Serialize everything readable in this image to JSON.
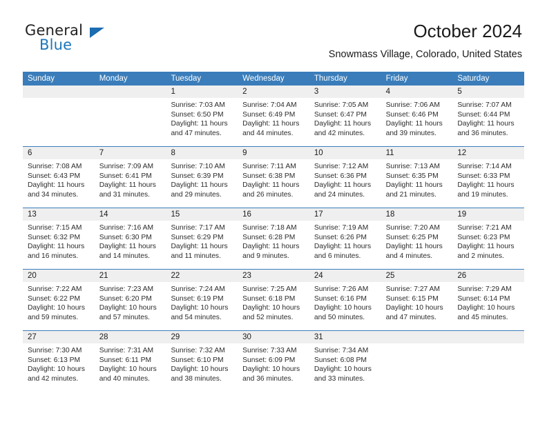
{
  "brand": {
    "word_one": "General",
    "word_two": "Blue",
    "accent_color": "#1b76bc",
    "triangle_color": "#1b6cb0"
  },
  "header": {
    "title": "October 2024",
    "subtitle": "Snowmass Village, Colorado, United States"
  },
  "calendar": {
    "header_color": "#3a7dba",
    "daynum_band_color": "#efefef",
    "day_names": [
      "Sunday",
      "Monday",
      "Tuesday",
      "Wednesday",
      "Thursday",
      "Friday",
      "Saturday"
    ],
    "weeks": [
      [
        {
          "day": "",
          "empty": true,
          "sunrise": "",
          "sunset": "",
          "daylight_line1": "",
          "daylight_line2": ""
        },
        {
          "day": "",
          "empty": true,
          "sunrise": "",
          "sunset": "",
          "daylight_line1": "",
          "daylight_line2": ""
        },
        {
          "day": "1",
          "empty": false,
          "sunrise": "Sunrise: 7:03 AM",
          "sunset": "Sunset: 6:50 PM",
          "daylight_line1": "Daylight: 11 hours",
          "daylight_line2": "and 47 minutes."
        },
        {
          "day": "2",
          "empty": false,
          "sunrise": "Sunrise: 7:04 AM",
          "sunset": "Sunset: 6:49 PM",
          "daylight_line1": "Daylight: 11 hours",
          "daylight_line2": "and 44 minutes."
        },
        {
          "day": "3",
          "empty": false,
          "sunrise": "Sunrise: 7:05 AM",
          "sunset": "Sunset: 6:47 PM",
          "daylight_line1": "Daylight: 11 hours",
          "daylight_line2": "and 42 minutes."
        },
        {
          "day": "4",
          "empty": false,
          "sunrise": "Sunrise: 7:06 AM",
          "sunset": "Sunset: 6:46 PM",
          "daylight_line1": "Daylight: 11 hours",
          "daylight_line2": "and 39 minutes."
        },
        {
          "day": "5",
          "empty": false,
          "sunrise": "Sunrise: 7:07 AM",
          "sunset": "Sunset: 6:44 PM",
          "daylight_line1": "Daylight: 11 hours",
          "daylight_line2": "and 36 minutes."
        }
      ],
      [
        {
          "day": "6",
          "empty": false,
          "sunrise": "Sunrise: 7:08 AM",
          "sunset": "Sunset: 6:43 PM",
          "daylight_line1": "Daylight: 11 hours",
          "daylight_line2": "and 34 minutes."
        },
        {
          "day": "7",
          "empty": false,
          "sunrise": "Sunrise: 7:09 AM",
          "sunset": "Sunset: 6:41 PM",
          "daylight_line1": "Daylight: 11 hours",
          "daylight_line2": "and 31 minutes."
        },
        {
          "day": "8",
          "empty": false,
          "sunrise": "Sunrise: 7:10 AM",
          "sunset": "Sunset: 6:39 PM",
          "daylight_line1": "Daylight: 11 hours",
          "daylight_line2": "and 29 minutes."
        },
        {
          "day": "9",
          "empty": false,
          "sunrise": "Sunrise: 7:11 AM",
          "sunset": "Sunset: 6:38 PM",
          "daylight_line1": "Daylight: 11 hours",
          "daylight_line2": "and 26 minutes."
        },
        {
          "day": "10",
          "empty": false,
          "sunrise": "Sunrise: 7:12 AM",
          "sunset": "Sunset: 6:36 PM",
          "daylight_line1": "Daylight: 11 hours",
          "daylight_line2": "and 24 minutes."
        },
        {
          "day": "11",
          "empty": false,
          "sunrise": "Sunrise: 7:13 AM",
          "sunset": "Sunset: 6:35 PM",
          "daylight_line1": "Daylight: 11 hours",
          "daylight_line2": "and 21 minutes."
        },
        {
          "day": "12",
          "empty": false,
          "sunrise": "Sunrise: 7:14 AM",
          "sunset": "Sunset: 6:33 PM",
          "daylight_line1": "Daylight: 11 hours",
          "daylight_line2": "and 19 minutes."
        }
      ],
      [
        {
          "day": "13",
          "empty": false,
          "sunrise": "Sunrise: 7:15 AM",
          "sunset": "Sunset: 6:32 PM",
          "daylight_line1": "Daylight: 11 hours",
          "daylight_line2": "and 16 minutes."
        },
        {
          "day": "14",
          "empty": false,
          "sunrise": "Sunrise: 7:16 AM",
          "sunset": "Sunset: 6:30 PM",
          "daylight_line1": "Daylight: 11 hours",
          "daylight_line2": "and 14 minutes."
        },
        {
          "day": "15",
          "empty": false,
          "sunrise": "Sunrise: 7:17 AM",
          "sunset": "Sunset: 6:29 PM",
          "daylight_line1": "Daylight: 11 hours",
          "daylight_line2": "and 11 minutes."
        },
        {
          "day": "16",
          "empty": false,
          "sunrise": "Sunrise: 7:18 AM",
          "sunset": "Sunset: 6:28 PM",
          "daylight_line1": "Daylight: 11 hours",
          "daylight_line2": "and 9 minutes."
        },
        {
          "day": "17",
          "empty": false,
          "sunrise": "Sunrise: 7:19 AM",
          "sunset": "Sunset: 6:26 PM",
          "daylight_line1": "Daylight: 11 hours",
          "daylight_line2": "and 6 minutes."
        },
        {
          "day": "18",
          "empty": false,
          "sunrise": "Sunrise: 7:20 AM",
          "sunset": "Sunset: 6:25 PM",
          "daylight_line1": "Daylight: 11 hours",
          "daylight_line2": "and 4 minutes."
        },
        {
          "day": "19",
          "empty": false,
          "sunrise": "Sunrise: 7:21 AM",
          "sunset": "Sunset: 6:23 PM",
          "daylight_line1": "Daylight: 11 hours",
          "daylight_line2": "and 2 minutes."
        }
      ],
      [
        {
          "day": "20",
          "empty": false,
          "sunrise": "Sunrise: 7:22 AM",
          "sunset": "Sunset: 6:22 PM",
          "daylight_line1": "Daylight: 10 hours",
          "daylight_line2": "and 59 minutes."
        },
        {
          "day": "21",
          "empty": false,
          "sunrise": "Sunrise: 7:23 AM",
          "sunset": "Sunset: 6:20 PM",
          "daylight_line1": "Daylight: 10 hours",
          "daylight_line2": "and 57 minutes."
        },
        {
          "day": "22",
          "empty": false,
          "sunrise": "Sunrise: 7:24 AM",
          "sunset": "Sunset: 6:19 PM",
          "daylight_line1": "Daylight: 10 hours",
          "daylight_line2": "and 54 minutes."
        },
        {
          "day": "23",
          "empty": false,
          "sunrise": "Sunrise: 7:25 AM",
          "sunset": "Sunset: 6:18 PM",
          "daylight_line1": "Daylight: 10 hours",
          "daylight_line2": "and 52 minutes."
        },
        {
          "day": "24",
          "empty": false,
          "sunrise": "Sunrise: 7:26 AM",
          "sunset": "Sunset: 6:16 PM",
          "daylight_line1": "Daylight: 10 hours",
          "daylight_line2": "and 50 minutes."
        },
        {
          "day": "25",
          "empty": false,
          "sunrise": "Sunrise: 7:27 AM",
          "sunset": "Sunset: 6:15 PM",
          "daylight_line1": "Daylight: 10 hours",
          "daylight_line2": "and 47 minutes."
        },
        {
          "day": "26",
          "empty": false,
          "sunrise": "Sunrise: 7:29 AM",
          "sunset": "Sunset: 6:14 PM",
          "daylight_line1": "Daylight: 10 hours",
          "daylight_line2": "and 45 minutes."
        }
      ],
      [
        {
          "day": "27",
          "empty": false,
          "sunrise": "Sunrise: 7:30 AM",
          "sunset": "Sunset: 6:13 PM",
          "daylight_line1": "Daylight: 10 hours",
          "daylight_line2": "and 42 minutes."
        },
        {
          "day": "28",
          "empty": false,
          "sunrise": "Sunrise: 7:31 AM",
          "sunset": "Sunset: 6:11 PM",
          "daylight_line1": "Daylight: 10 hours",
          "daylight_line2": "and 40 minutes."
        },
        {
          "day": "29",
          "empty": false,
          "sunrise": "Sunrise: 7:32 AM",
          "sunset": "Sunset: 6:10 PM",
          "daylight_line1": "Daylight: 10 hours",
          "daylight_line2": "and 38 minutes."
        },
        {
          "day": "30",
          "empty": false,
          "sunrise": "Sunrise: 7:33 AM",
          "sunset": "Sunset: 6:09 PM",
          "daylight_line1": "Daylight: 10 hours",
          "daylight_line2": "and 36 minutes."
        },
        {
          "day": "31",
          "empty": false,
          "sunrise": "Sunrise: 7:34 AM",
          "sunset": "Sunset: 6:08 PM",
          "daylight_line1": "Daylight: 10 hours",
          "daylight_line2": "and 33 minutes."
        },
        {
          "day": "",
          "empty": true,
          "sunrise": "",
          "sunset": "",
          "daylight_line1": "",
          "daylight_line2": ""
        },
        {
          "day": "",
          "empty": true,
          "sunrise": "",
          "sunset": "",
          "daylight_line1": "",
          "daylight_line2": ""
        }
      ]
    ]
  }
}
